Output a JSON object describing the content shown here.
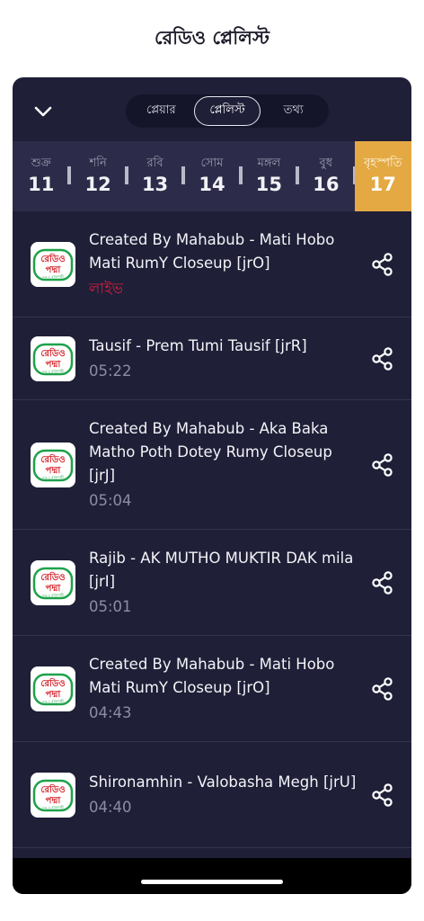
{
  "page": {
    "title": "রেডিও প্লেলিস্ট"
  },
  "tabs": [
    {
      "label": "প্লেয়ার",
      "active": false
    },
    {
      "label": "প্লেলিস্ট",
      "active": true
    },
    {
      "label": "তথ্য",
      "active": false
    }
  ],
  "days": [
    {
      "name": "শুক্র",
      "num": "11"
    },
    {
      "name": "শনি",
      "num": "12"
    },
    {
      "name": "রবি",
      "num": "13"
    },
    {
      "name": "সোম",
      "num": "14"
    },
    {
      "name": "মঙ্গল",
      "num": "15"
    },
    {
      "name": "বুধ",
      "num": "16"
    },
    {
      "name": "বৃহস্পতি",
      "num": "17",
      "active": true
    }
  ],
  "logo": {
    "line1": "রেডিও",
    "line2": "পদ্মা",
    "tagline": "৯৯.২ রাজশাহী",
    "border": "#1ea24a",
    "text": "#d6262e"
  },
  "tracks": [
    {
      "title": "Created By Mahabub - Mati Hobo Mati RumY Closeup [jrO]",
      "sub": "লাইভ",
      "live": true
    },
    {
      "title": "Tausif - Prem Tumi Tausif [jrR]",
      "sub": "05:22"
    },
    {
      "title": "Created By Mahabub - Aka Baka Matho Poth Dotey Rumy Closeup [jrJ]",
      "sub": "05:04"
    },
    {
      "title": "Rajib - AK MUTHO MUKTIR DAK mila [jrI]",
      "sub": "05:01"
    },
    {
      "title": "Created By Mahabub - Mati Hobo Mati RumY Closeup [jrO]",
      "sub": "04:43"
    },
    {
      "title": "Shironamhin - Valobasha Megh [jrU]",
      "sub": "04:40"
    }
  ],
  "colors": {
    "panel": "#1f1f38",
    "active_day": "#e4a943",
    "live": "#d21f3c"
  }
}
